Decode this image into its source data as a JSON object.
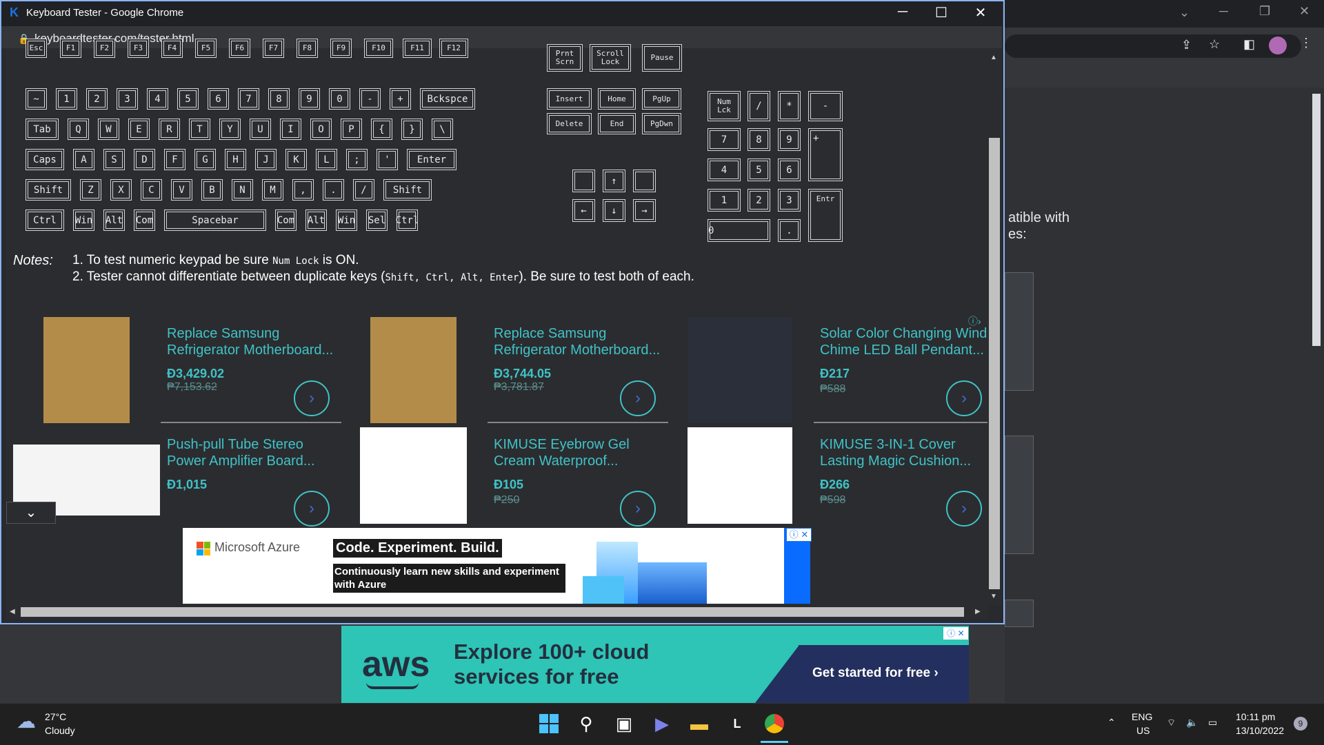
{
  "window": {
    "title": "Keyboard Tester - Google Chrome",
    "url": "keyboardtester.com/tester.html"
  },
  "keys": {
    "fn_row": [
      "Esc",
      "F1",
      "F2",
      "F3",
      "F4",
      "F5",
      "F6",
      "F7",
      "F8",
      "F9",
      "F10",
      "F11",
      "F12"
    ],
    "num_row": [
      "~",
      "1",
      "2",
      "3",
      "4",
      "5",
      "6",
      "7",
      "8",
      "9",
      "0",
      "-",
      "+",
      "Bckspce"
    ],
    "tab_row": [
      "Tab",
      "Q",
      "W",
      "E",
      "R",
      "T",
      "Y",
      "U",
      "I",
      "O",
      "P",
      "{",
      "}",
      "\\"
    ],
    "caps_row": [
      "Caps",
      "A",
      "S",
      "D",
      "F",
      "G",
      "H",
      "J",
      "K",
      "L",
      ";",
      "'",
      "Enter"
    ],
    "shift_row": [
      "Shift",
      "Z",
      "X",
      "C",
      "V",
      "B",
      "N",
      "M",
      ",",
      ".",
      "/",
      "Shift"
    ],
    "bottom_row": [
      "Ctrl",
      "Win",
      "Alt",
      "Com",
      "Spacebar",
      "Com",
      "Alt",
      "Win",
      "Sel",
      "Ctrl"
    ],
    "sys": [
      "Prnt Scrn",
      "Scroll Lock",
      "Pause"
    ],
    "nav1": [
      "Insert",
      "Home",
      "PgUp"
    ],
    "nav2": [
      "Delete",
      "End",
      "PgDwn"
    ],
    "arrows": {
      "up": "↑",
      "left": "←",
      "down": "↓",
      "right": "→"
    },
    "numpad": {
      "numlock": "Num Lck",
      "div": "/",
      "mul": "*",
      "minus": "-",
      "plus": "+",
      "n7": "7",
      "n8": "8",
      "n9": "9",
      "n4": "4",
      "n5": "5",
      "n6": "6",
      "n1": "1",
      "n2": "2",
      "n3": "3",
      "n0": "0",
      "dot": ".",
      "enter": "Entr"
    }
  },
  "notes": {
    "label": "Notes:",
    "n1_pre": "1. To test numeric keypad be sure ",
    "n1_code": "Num Lock",
    "n1_post": " is ON.",
    "n2_pre": "2. Tester cannot differentiate between duplicate keys (",
    "n2_code": "Shift, Ctrl, Alt, Enter",
    "n2_post": "). Be sure to test both of each."
  },
  "products": [
    {
      "title": "Replace Samsung Refrigerator Motherboard...",
      "price": "Đ3,429.02",
      "old": "₱7,153.62"
    },
    {
      "title": "Replace Samsung Refrigerator Motherboard...",
      "price": "Đ3,744.05",
      "old": "₱3,781.87"
    },
    {
      "title": "Solar Color Changing Wind Chime LED Ball Pendant...",
      "price": "Đ217",
      "old": "₱588"
    },
    {
      "title": "Push-pull Tube Stereo Power Amplifier Board...",
      "price": "Đ1,015",
      "old": ""
    },
    {
      "title": "KIMUSE Eyebrow Gel Cream Waterproof...",
      "price": "Đ105",
      "old": "₱250"
    },
    {
      "title": "KIMUSE 3-IN-1 Cover Lasting Magic Cushion...",
      "price": "Đ266",
      "old": "₱598"
    }
  ],
  "azure_ad": {
    "brand": "Microsoft Azure",
    "headline": "Code. Experiment. Build.",
    "sub": "Continuously learn new skills and experiment with Azure"
  },
  "aws_ad": {
    "logo": "aws",
    "headline": "Explore 100+ cloud services for free",
    "cta": "Get started for free ›"
  },
  "bg_page": {
    "side_text": "atible with es:"
  },
  "taskbar": {
    "temp": "27°C",
    "weather": "Cloudy",
    "lang1": "ENG",
    "lang2": "US",
    "time": "10:11 pm",
    "date": "13/10/2022",
    "badge": "9"
  }
}
